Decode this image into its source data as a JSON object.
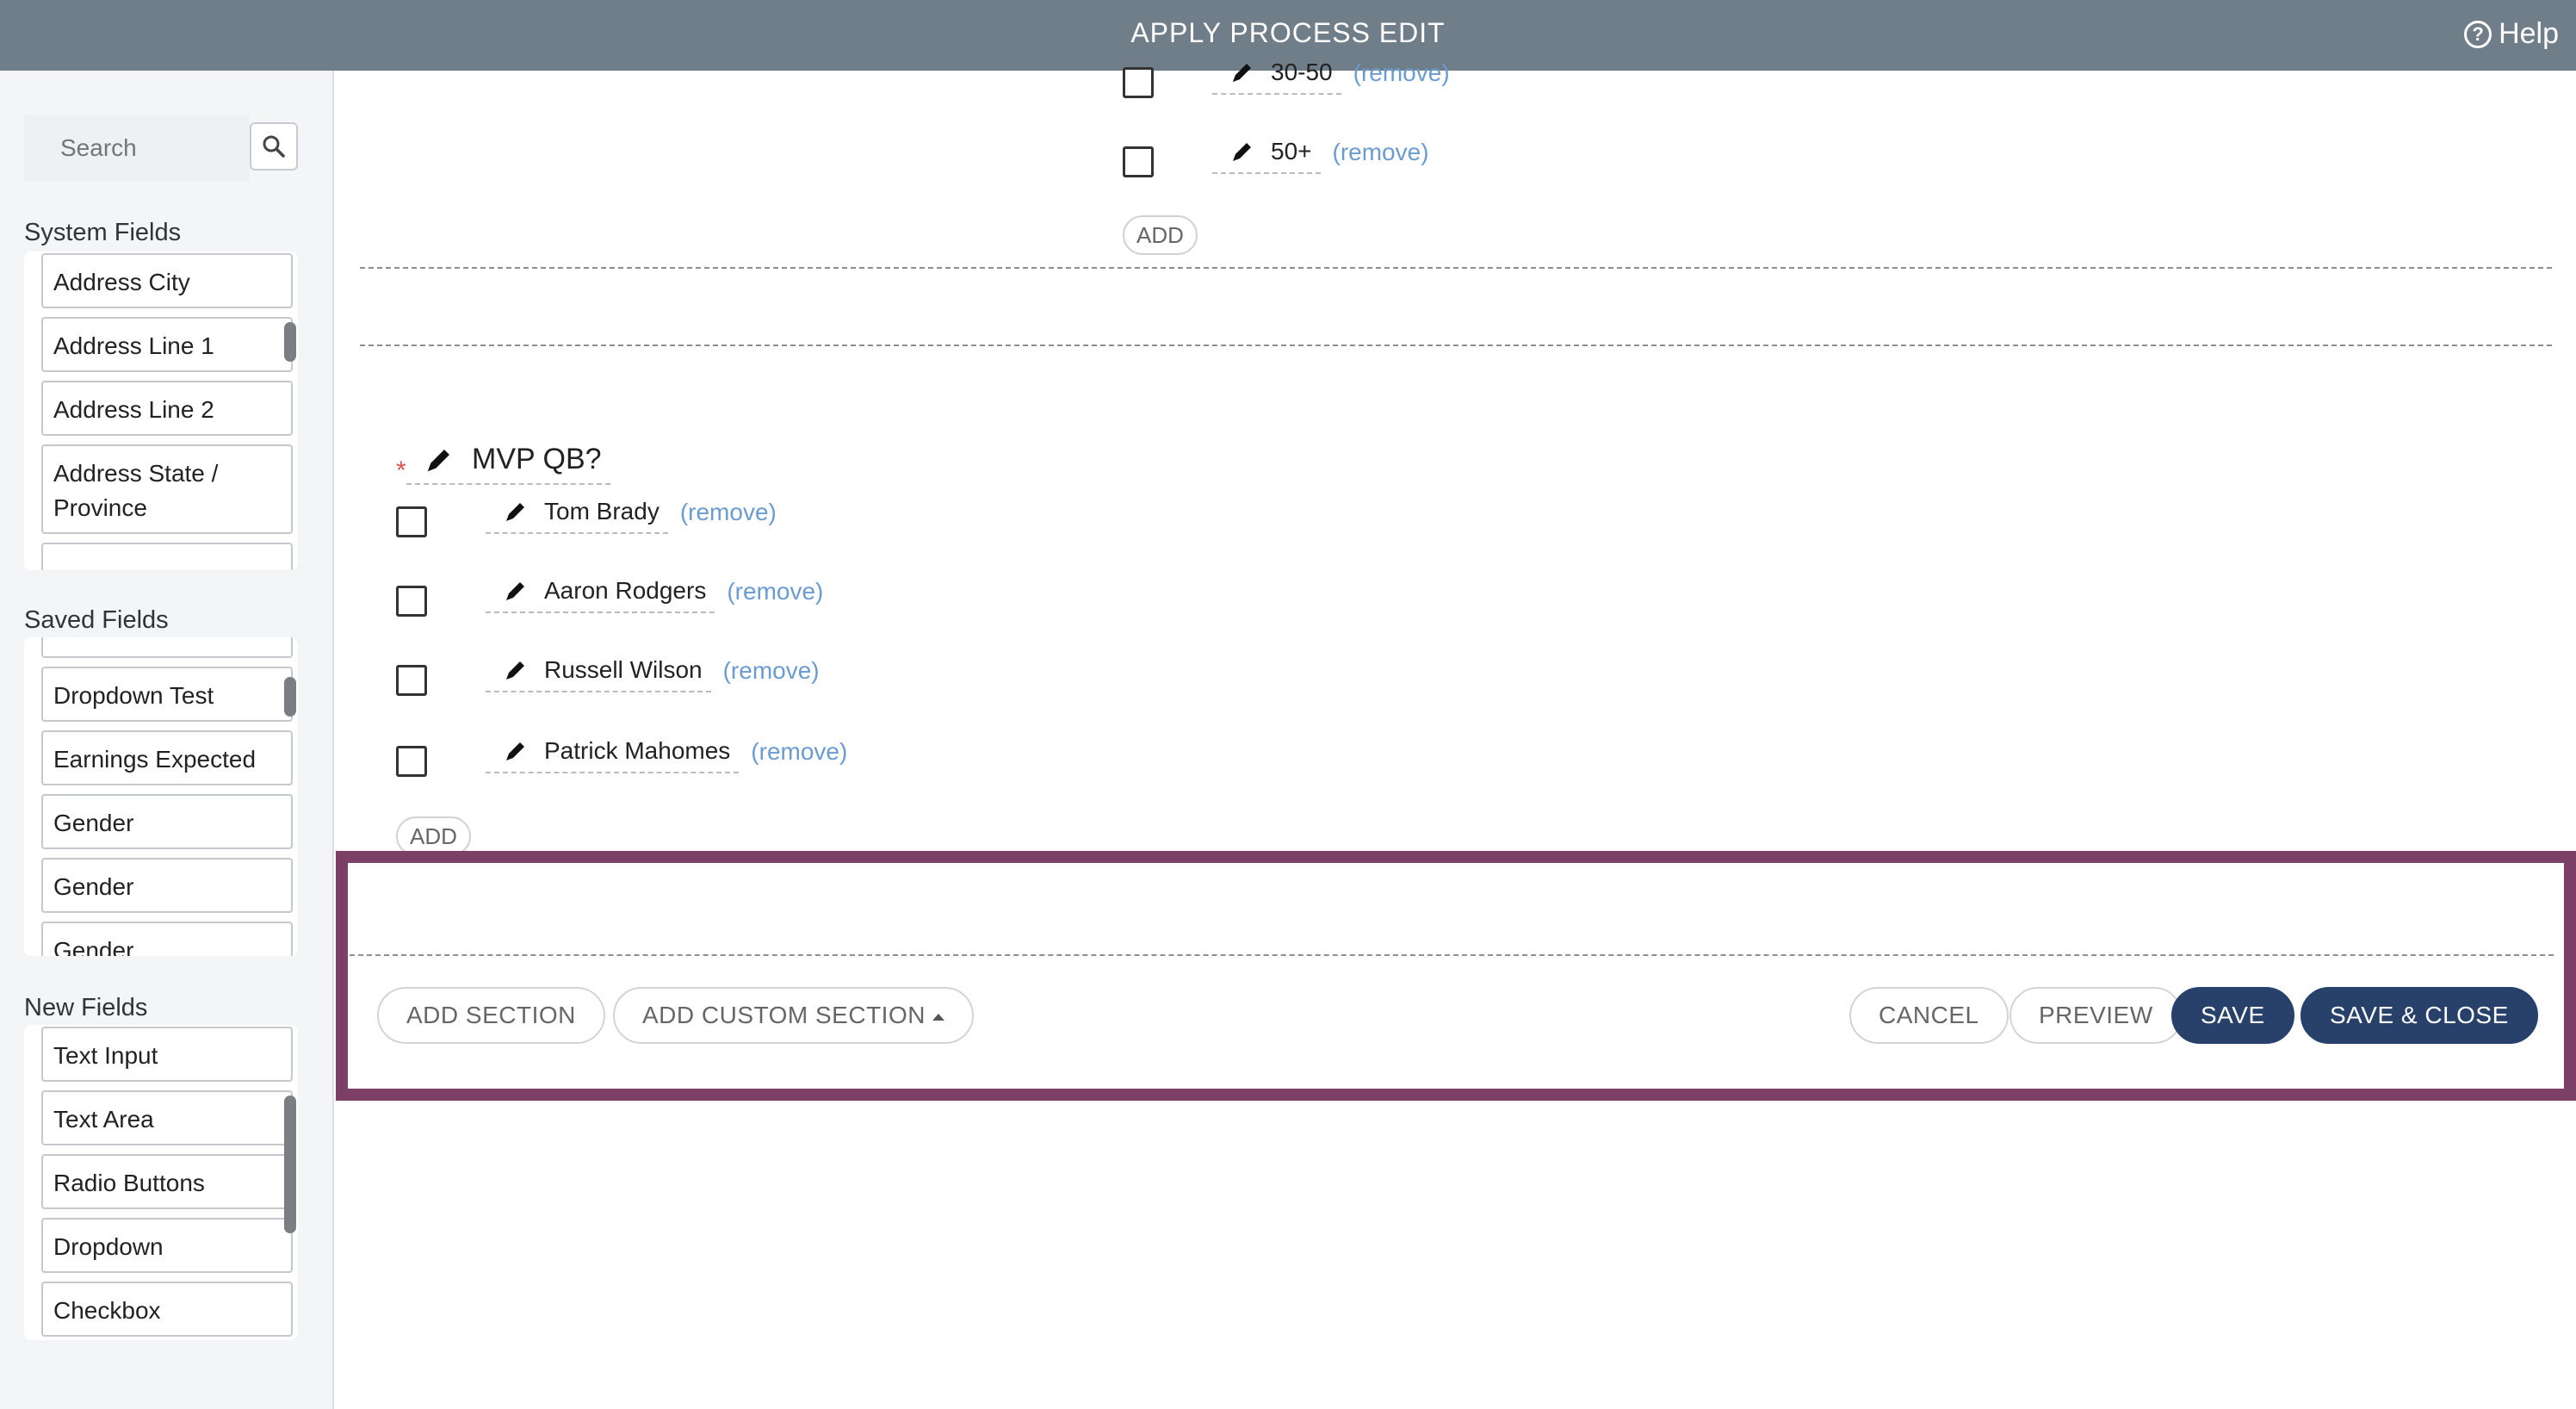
{
  "header": {
    "title": "APPLY PROCESS EDIT",
    "help_label": "Help",
    "help_icon": "question-circle-icon"
  },
  "sidebar": {
    "search_placeholder": "Search",
    "system_fields": {
      "title": "System Fields",
      "items": [
        "Address City",
        "Address Line 1",
        "Address Line 2",
        "Address State / Province"
      ]
    },
    "saved_fields": {
      "title": "Saved Fields",
      "items": [
        "Dropdown Test",
        "Earnings Expected",
        "Gender",
        "Gender",
        "Gender"
      ]
    },
    "new_fields": {
      "title": "New Fields",
      "items": [
        "Text Input",
        "Text Area",
        "Radio Buttons",
        "Dropdown",
        "Checkbox"
      ]
    }
  },
  "form": {
    "prev_options": [
      {
        "label": "30-50",
        "remove": "(remove)"
      },
      {
        "label": "50+",
        "remove": "(remove)"
      }
    ],
    "add_label": "ADD",
    "question": {
      "label": "MVP QB?",
      "required_mark": "*",
      "options": [
        {
          "label": "Tom Brady",
          "remove": "(remove)"
        },
        {
          "label": "Aaron Rodgers",
          "remove": "(remove)"
        },
        {
          "label": "Russell Wilson",
          "remove": "(remove)"
        },
        {
          "label": "Patrick Mahomes",
          "remove": "(remove)"
        }
      ],
      "add_label": "ADD"
    }
  },
  "footer": {
    "add_section": "ADD SECTION",
    "add_custom_section": "ADD CUSTOM SECTION",
    "cancel": "CANCEL",
    "preview": "PREVIEW",
    "save": "SAVE",
    "save_close": "SAVE & CLOSE"
  },
  "colors": {
    "header_bg": "#707e89",
    "primary_button": "#27416b",
    "highlight_border": "#7c3f66",
    "link": "#6a9bd1"
  }
}
